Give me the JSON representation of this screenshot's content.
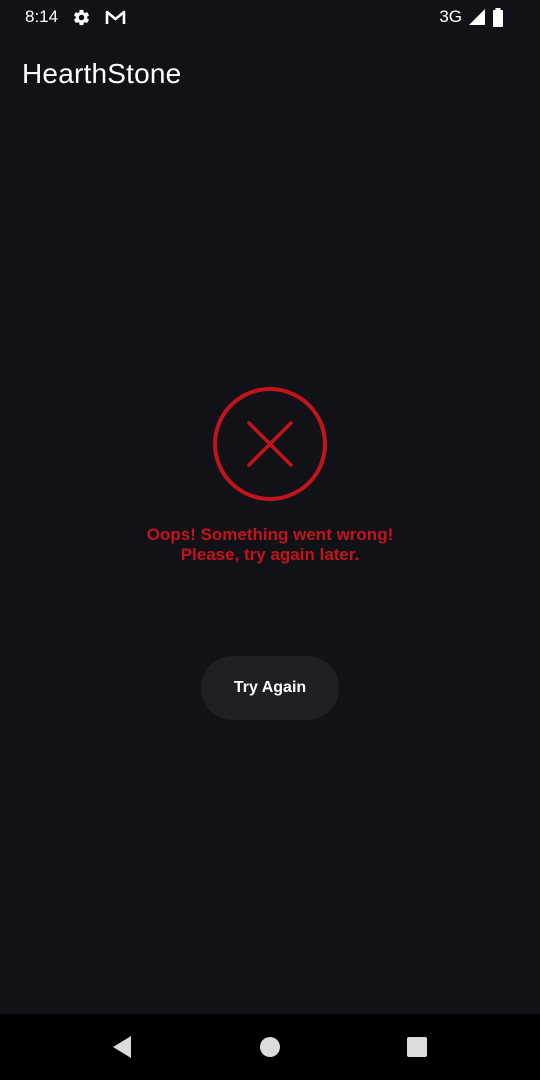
{
  "status_bar": {
    "time": "8:14",
    "network": "3G",
    "icons": [
      "settings-icon",
      "gmail-icon",
      "signal-icon",
      "battery-icon"
    ]
  },
  "app_bar": {
    "title": "HearthStone"
  },
  "error": {
    "icon": "error-x-circle-icon",
    "line1": "Oops! Something went wrong!",
    "line2": "Please, try again later.",
    "color": "#c4141b"
  },
  "retry": {
    "label": "Try Again"
  },
  "nav_bar": {
    "icons": [
      "back-icon",
      "home-icon",
      "recents-icon"
    ]
  },
  "colors": {
    "background": "#111217",
    "button": "#1f2025",
    "accent_error": "#c4141b"
  }
}
